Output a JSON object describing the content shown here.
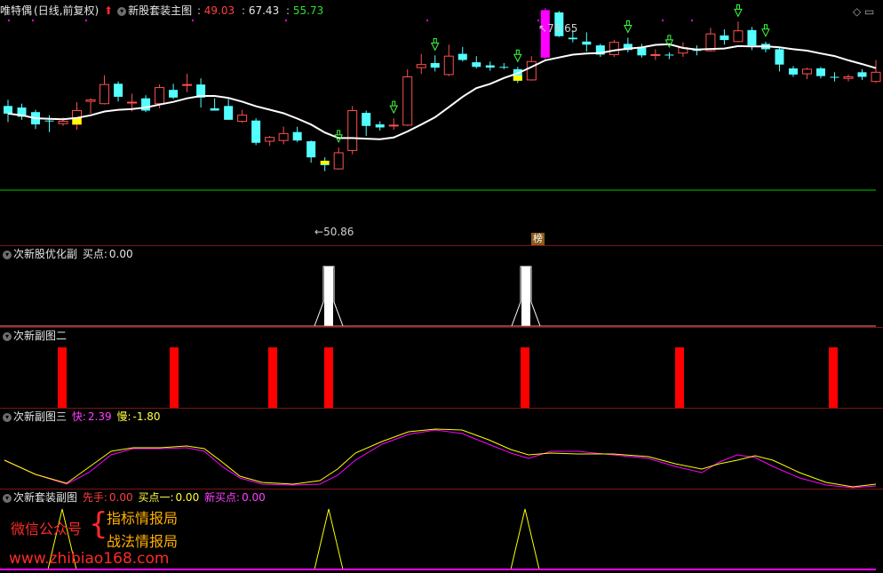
{
  "main": {
    "stock_name": "唯特偶",
    "period": "(日线,前复权)",
    "indicator": "新股套装主图",
    "val1": "49.03",
    "val2": "67.43",
    "val3": "55.73",
    "high_label": "75.65",
    "low_label": "50.86",
    "bang": "榜"
  },
  "sub1": {
    "title": "次新股优化副",
    "buy_label": "买点:",
    "buy_value": "0.00"
  },
  "sub2": {
    "title": "次新副图二"
  },
  "sub3": {
    "title": "次新副图三",
    "fast_label": "快:",
    "fast_value": "2.39",
    "slow_label": "慢:",
    "slow_value": "-1.80"
  },
  "sub4": {
    "title": "次新套装副图",
    "l1": "先手:",
    "v1": "0.00",
    "l2": "买点一:",
    "v2": "0.00",
    "l3": "新买点:",
    "v3": "0.00"
  },
  "watermark": {
    "line1": "微信公众号",
    "brace": "{",
    "a": "指标情报局",
    "b": "战法情报局",
    "url": "www.zhibiao168.com"
  },
  "colors": {
    "up": "#ff5050",
    "down": "#54ffff",
    "ma": "#ffffff",
    "support": "#00c800",
    "magenta": "#ff00ff",
    "yellow": "#ffff00",
    "bar": "#ff0000"
  },
  "candles": [
    {
      "o": 66.0,
      "c": 65.0,
      "h": 66.8,
      "l": 63.9,
      "t": "d"
    },
    {
      "o": 65.8,
      "c": 64.6,
      "h": 66.3,
      "l": 64.2,
      "t": "d"
    },
    {
      "o": 65.2,
      "c": 63.6,
      "h": 65.5,
      "l": 63.0,
      "t": "d"
    },
    {
      "o": 64.1,
      "c": 64.1,
      "h": 64.8,
      "l": 62.6,
      "t": "d"
    },
    {
      "o": 63.7,
      "c": 64.0,
      "h": 64.5,
      "l": 63.4,
      "t": "u"
    },
    {
      "o": 63.6,
      "c": 65.4,
      "h": 66.5,
      "l": 62.9,
      "t": "u"
    },
    {
      "o": 66.6,
      "c": 66.8,
      "h": 67.0,
      "l": 65.0,
      "t": "u"
    },
    {
      "o": 66.3,
      "c": 68.8,
      "h": 70.0,
      "l": 66.2,
      "t": "u"
    },
    {
      "o": 68.9,
      "c": 67.2,
      "h": 69.2,
      "l": 66.6,
      "t": "d"
    },
    {
      "o": 66.4,
      "c": 66.5,
      "h": 67.6,
      "l": 65.3,
      "t": "u"
    },
    {
      "o": 65.4,
      "c": 67.0,
      "h": 67.4,
      "l": 65.2,
      "t": "d"
    },
    {
      "o": 66.3,
      "c": 68.4,
      "h": 68.8,
      "l": 65.7,
      "t": "u"
    },
    {
      "o": 68.1,
      "c": 67.1,
      "h": 68.9,
      "l": 66.9,
      "t": "d"
    },
    {
      "o": 68.7,
      "c": 68.8,
      "h": 70.2,
      "l": 67.8,
      "t": "u"
    },
    {
      "o": 68.8,
      "c": 67.1,
      "h": 69.6,
      "l": 65.8,
      "t": "d"
    },
    {
      "o": 65.7,
      "c": 65.4,
      "h": 67.0,
      "l": 65.4,
      "t": "d"
    },
    {
      "o": 66.0,
      "c": 64.2,
      "h": 66.9,
      "l": 64.2,
      "t": "d"
    },
    {
      "o": 64.8,
      "c": 64.0,
      "h": 65.5,
      "l": 63.8,
      "t": "u"
    },
    {
      "o": 64.1,
      "c": 61.2,
      "h": 64.4,
      "l": 60.9,
      "t": "d"
    },
    {
      "o": 61.4,
      "c": 61.9,
      "h": 62.1,
      "l": 60.8,
      "t": "u"
    },
    {
      "o": 61.5,
      "c": 62.4,
      "h": 63.3,
      "l": 61.0,
      "t": "u"
    },
    {
      "o": 62.6,
      "c": 61.5,
      "h": 63.3,
      "l": 61.3,
      "t": "d"
    },
    {
      "o": 61.4,
      "c": 59.3,
      "h": 61.5,
      "l": 58.6,
      "t": "d"
    },
    {
      "o": 58.4,
      "c": 58.4,
      "h": 59.3,
      "l": 57.5,
      "t": "d"
    },
    {
      "o": 57.8,
      "c": 59.9,
      "h": 60.6,
      "l": 57.7,
      "t": "u"
    },
    {
      "o": 60.2,
      "c": 65.4,
      "h": 66.0,
      "l": 59.7,
      "t": "u"
    },
    {
      "o": 65.1,
      "c": 63.4,
      "h": 65.4,
      "l": 62.1,
      "t": "d"
    },
    {
      "o": 63.6,
      "c": 63.2,
      "h": 64.0,
      "l": 62.8,
      "t": "d"
    },
    {
      "o": 63.5,
      "c": 63.5,
      "h": 64.4,
      "l": 62.9,
      "t": "u"
    },
    {
      "o": 63.5,
      "c": 69.8,
      "h": 70.8,
      "l": 63.4,
      "t": "u"
    },
    {
      "o": 71.0,
      "c": 71.4,
      "h": 72.8,
      "l": 70.2,
      "t": "u"
    },
    {
      "o": 71.6,
      "c": 71.0,
      "h": 72.6,
      "l": 70.5,
      "t": "d"
    },
    {
      "o": 70.1,
      "c": 72.5,
      "h": 74.0,
      "l": 69.9,
      "t": "u"
    },
    {
      "o": 72.8,
      "c": 72.0,
      "h": 73.7,
      "l": 71.8,
      "t": "d"
    },
    {
      "o": 71.7,
      "c": 71.1,
      "h": 72.5,
      "l": 70.9,
      "t": "d"
    },
    {
      "o": 71.3,
      "c": 71.0,
      "h": 71.8,
      "l": 70.6,
      "t": "d"
    },
    {
      "o": 71.1,
      "c": 71.0,
      "h": 71.6,
      "l": 70.8,
      "t": "d"
    },
    {
      "o": 70.8,
      "c": 69.3,
      "h": 71.1,
      "l": 69.0,
      "t": "d"
    },
    {
      "o": 69.4,
      "c": 71.8,
      "h": 72.5,
      "l": 69.3,
      "t": "u"
    },
    {
      "o": 72.3,
      "c": 78.5,
      "h": 78.8,
      "l": 72.1,
      "t": "m"
    },
    {
      "o": 78.2,
      "c": 75.1,
      "h": 78.4,
      "l": 75.0,
      "t": "d"
    },
    {
      "o": 74.9,
      "c": 74.7,
      "h": 75.9,
      "l": 74.3,
      "t": "d"
    },
    {
      "o": 74.4,
      "c": 74.0,
      "h": 75.6,
      "l": 73.1,
      "t": "d"
    },
    {
      "o": 73.9,
      "c": 72.7,
      "h": 74.1,
      "l": 72.4,
      "t": "d"
    },
    {
      "o": 72.7,
      "c": 74.3,
      "h": 74.6,
      "l": 72.4,
      "t": "u"
    },
    {
      "o": 74.1,
      "c": 73.3,
      "h": 74.9,
      "l": 73.0,
      "t": "d"
    },
    {
      "o": 73.6,
      "c": 72.6,
      "h": 74.1,
      "l": 72.3,
      "t": "d"
    },
    {
      "o": 72.6,
      "c": 72.7,
      "h": 73.4,
      "l": 72.0,
      "t": "u"
    },
    {
      "o": 72.7,
      "c": 72.6,
      "h": 73.0,
      "l": 72.1,
      "t": "d"
    },
    {
      "o": 72.9,
      "c": 73.6,
      "h": 74.3,
      "l": 72.4,
      "t": "u"
    },
    {
      "o": 73.3,
      "c": 73.2,
      "h": 73.9,
      "l": 72.6,
      "t": "d"
    },
    {
      "o": 73.2,
      "c": 75.4,
      "h": 76.2,
      "l": 73.1,
      "t": "u"
    },
    {
      "o": 75.2,
      "c": 74.6,
      "h": 76.0,
      "l": 74.0,
      "t": "d"
    },
    {
      "o": 74.4,
      "c": 75.8,
      "h": 77.0,
      "l": 74.3,
      "t": "u"
    },
    {
      "o": 75.9,
      "c": 73.9,
      "h": 76.3,
      "l": 73.3,
      "t": "d"
    },
    {
      "o": 74.1,
      "c": 73.4,
      "h": 74.4,
      "l": 73.0,
      "t": "d"
    },
    {
      "o": 73.4,
      "c": 71.4,
      "h": 73.7,
      "l": 70.5,
      "t": "d"
    },
    {
      "o": 70.9,
      "c": 70.1,
      "h": 71.2,
      "l": 69.8,
      "t": "d"
    },
    {
      "o": 70.2,
      "c": 70.8,
      "h": 71.0,
      "l": 69.5,
      "t": "u"
    },
    {
      "o": 70.9,
      "c": 69.9,
      "h": 71.1,
      "l": 69.6,
      "t": "d"
    },
    {
      "o": 69.8,
      "c": 69.8,
      "h": 70.4,
      "l": 69.2,
      "t": "d"
    },
    {
      "o": 69.6,
      "c": 69.8,
      "h": 70.1,
      "l": 69.2,
      "t": "u"
    },
    {
      "o": 70.4,
      "c": 69.8,
      "h": 70.8,
      "l": 69.4,
      "t": "d"
    },
    {
      "o": 69.2,
      "c": 70.4,
      "h": 72.0,
      "l": 69.0,
      "t": "u"
    }
  ]
}
